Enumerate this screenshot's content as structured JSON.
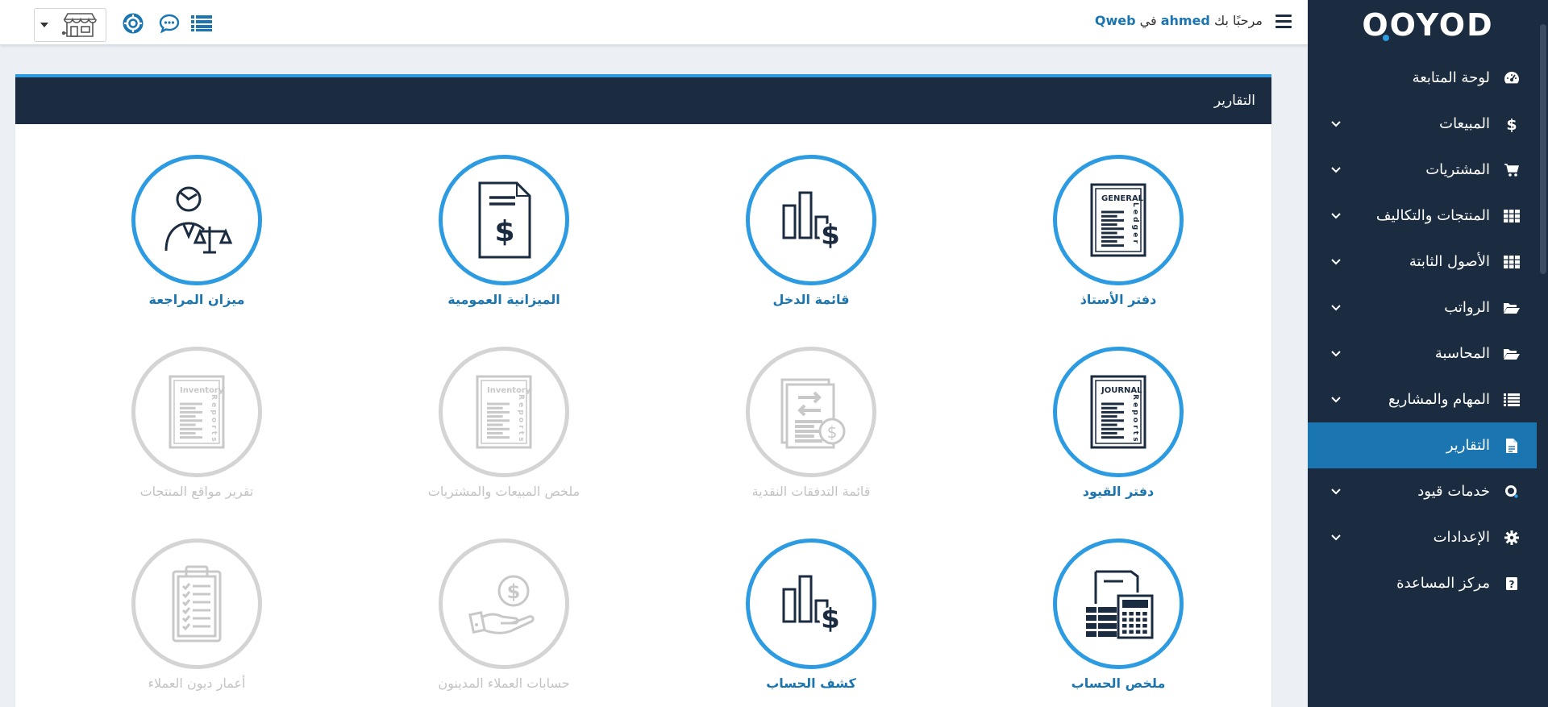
{
  "brand": {
    "logo_text": "OOYOD",
    "accent": "#2d9be2",
    "sidebar_bg": "#1b2c41",
    "active_bg": "#1a75b0"
  },
  "topbar": {
    "welcome_prefix": "مرحبًا بك",
    "user": "ahmed",
    "in_word": "في",
    "company": "Qweb"
  },
  "sidebar": {
    "items": [
      {
        "label": "لوحة المتابعة",
        "icon": "dashboard-icon",
        "has_submenu": false
      },
      {
        "label": "المبيعات",
        "icon": "dollar-icon",
        "has_submenu": true
      },
      {
        "label": "المشتريات",
        "icon": "cart-icon",
        "has_submenu": true
      },
      {
        "label": "المنتجات والتكاليف",
        "icon": "grid-icon",
        "has_submenu": true
      },
      {
        "label": "الأصول الثابتة",
        "icon": "grid-icon",
        "has_submenu": true
      },
      {
        "label": "الرواتب",
        "icon": "folder-open-icon",
        "has_submenu": true
      },
      {
        "label": "المحاسبة",
        "icon": "folder-open-icon",
        "has_submenu": true
      },
      {
        "label": "المهام والمشاريع",
        "icon": "list-icon",
        "has_submenu": true
      },
      {
        "label": "التقارير",
        "icon": "file-icon",
        "has_submenu": false,
        "active": true
      },
      {
        "label": "خدمات قيود",
        "icon": "qoyod-icon",
        "has_submenu": true
      },
      {
        "label": "الإعدادات",
        "icon": "gear-icon",
        "has_submenu": true
      },
      {
        "label": "مركز المساعدة",
        "icon": "help-icon",
        "has_submenu": false
      }
    ]
  },
  "box": {
    "title": "التقارير"
  },
  "reports": [
    {
      "label": "دفتر الأستاذ",
      "icon": "general-ledger-icon",
      "enabled": true
    },
    {
      "label": "قائمة الدخل",
      "icon": "income-statement-icon",
      "enabled": true
    },
    {
      "label": "الميزانية العمومية",
      "icon": "balance-sheet-icon",
      "enabled": true
    },
    {
      "label": "ميزان المراجعة",
      "icon": "trial-balance-icon",
      "enabled": true
    },
    {
      "label": "دفتر القيود",
      "icon": "journal-reports-icon",
      "enabled": true
    },
    {
      "label": "قائمة التدفقات النقدية",
      "icon": "cash-flow-icon",
      "enabled": false
    },
    {
      "label": "ملخص المبيعات والمشتريات",
      "icon": "inventory-reports-icon",
      "enabled": false
    },
    {
      "label": "تقرير مواقع المنتجات",
      "icon": "inventory-reports-icon",
      "enabled": false
    },
    {
      "label": "ملخص الحساب",
      "icon": "account-summary-icon",
      "enabled": true
    },
    {
      "label": "كشف الحساب",
      "icon": "account-statement-icon",
      "enabled": true
    },
    {
      "label": "حسابات العملاء المدينون",
      "icon": "receivables-icon",
      "enabled": false
    },
    {
      "label": "أعمار ديون العملاء",
      "icon": "aging-clipboard-icon",
      "enabled": false
    }
  ],
  "icon_text": {
    "general": "GENERAL",
    "ledger": "Ledger",
    "journal": "JOURNAL",
    "reports": "Reports",
    "inventory": "Inventory",
    "dollar": "$"
  }
}
